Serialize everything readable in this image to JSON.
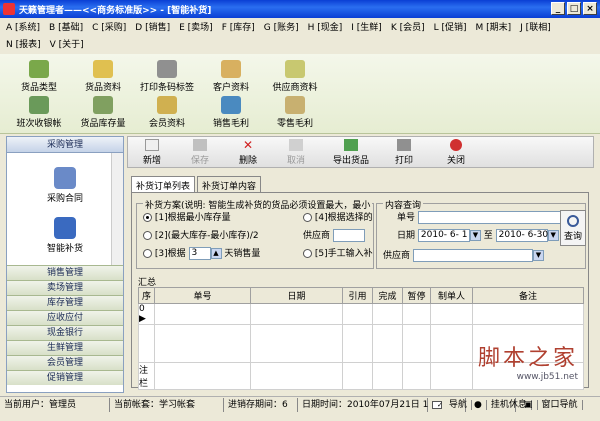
{
  "window": {
    "title": "天籁管理者——<<商务标准版>> - [智能补货]"
  },
  "menu": [
    "A [系统]",
    "B [基础]",
    "C [采购]",
    "D [销售]",
    "E [卖场]",
    "F [库存]",
    "G [账务]",
    "H [现金]",
    "I [生鲜]",
    "K [会员]",
    "L [促销]",
    "M [期末]",
    "J [联相]",
    "N [报表]",
    "V [关于]"
  ],
  "toolbar1": {
    "items": [
      "货品类型",
      "货品资料",
      "打印条码标签",
      "客户资料",
      "供应商资料",
      "班次收银帐",
      "货品库存量",
      "会员资料",
      "销售毛利",
      "零售毛利"
    ]
  },
  "left_panel": {
    "header": "采购管理",
    "items": [
      "采购合同",
      "智能补货"
    ],
    "nav": [
      "销售管理",
      "卖场管理",
      "库存管理",
      "应收应付",
      "现金银行",
      "生鲜管理",
      "会员管理",
      "促销管理"
    ]
  },
  "toolbar2": {
    "new": "新增",
    "save": "保存",
    "delete": "删除",
    "cancel": "取消",
    "export": "导出货品",
    "print": "打印",
    "close": "关闭"
  },
  "tabs": [
    "补货订单列表",
    "补货订单内容"
  ],
  "plan": {
    "title": "补货方案(说明: 智能生成补货的货品必须设置最大，最小",
    "opt1": "[1]根据最小库存量",
    "opt2": "[2](最大库存-最小库存)/2",
    "opt3": "[3]根据",
    "opt3_value": "3",
    "opt3_suffix": "天销售量",
    "opt4": "[4]根据选择的",
    "supplier_label": "供应商",
    "opt5": "[5]手工输入补"
  },
  "query": {
    "title": "内容查询",
    "order_label": "单号",
    "date_label": "日期",
    "date_from": "2010- 6- 1",
    "to_label": "至",
    "date_to": "2010- 6-30",
    "supplier_label": "供应商",
    "query_button": "查询"
  },
  "summary_label": "汇总",
  "table": {
    "headers": [
      "序",
      "单号",
      "日期",
      "引用",
      "完成",
      "暂停",
      "制单人",
      "备注"
    ],
    "row_index": "0",
    "footer_label": "注栏"
  },
  "statusbar": {
    "user": "当前用户：管理员",
    "account": "当前帐套：学习帐套",
    "period": "进销存期间：6",
    "date": "日期时间：2010年07月21日 1",
    "nav_check": "导航",
    "hangup": "挂机休息",
    "window_nav": "窗口导航"
  },
  "watermark": {
    "big": "脚本之家",
    "small": "www.jb51.net"
  }
}
